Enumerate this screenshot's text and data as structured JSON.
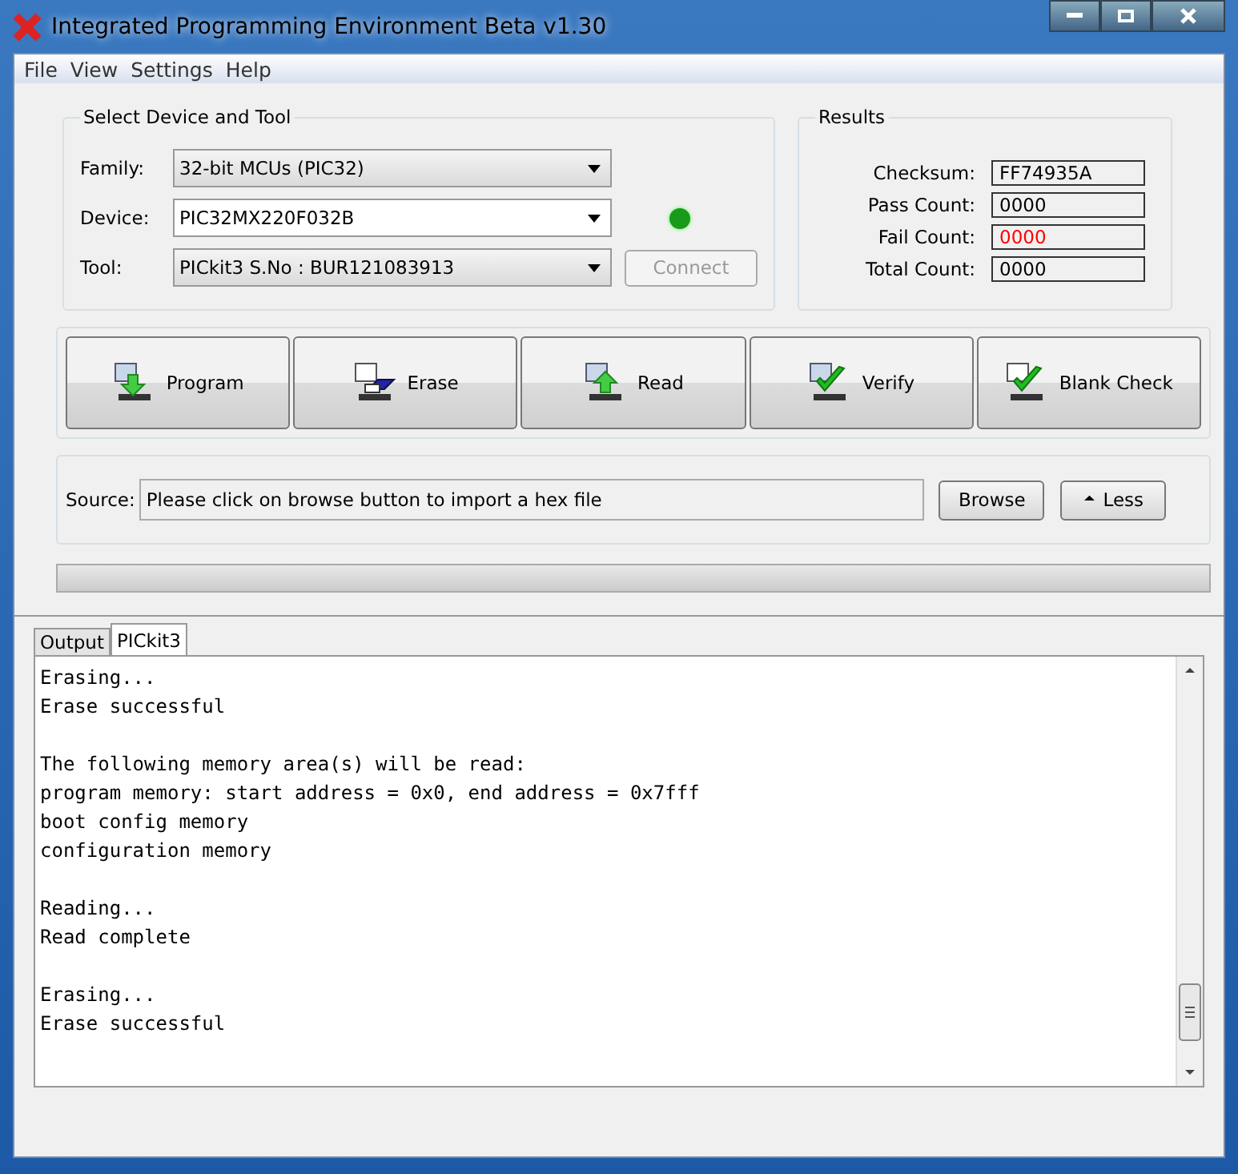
{
  "window": {
    "title": "Integrated Programming Environment Beta v1.30"
  },
  "menu": [
    "File",
    "View",
    "Settings",
    "Help"
  ],
  "device_panel": {
    "title": "Select Device and Tool",
    "fields": [
      {
        "label": "Family:",
        "value": "32-bit MCUs (PIC32)",
        "editable": false
      },
      {
        "label": "Device:",
        "value": "PIC32MX220F032B",
        "editable": true
      },
      {
        "label": "Tool:",
        "value": "PICkit3 S.No : BUR121083913",
        "editable": false
      }
    ],
    "status_led": {
      "on": true
    },
    "connect_button": {
      "label": "Connect",
      "disabled": true
    }
  },
  "results": {
    "title": "Results",
    "rows": [
      {
        "label": "Checksum:",
        "value": "FF74935A",
        "color": "#000000"
      },
      {
        "label": "Pass Count:",
        "value": "0000",
        "color": "#000000"
      },
      {
        "label": "Fail Count:",
        "value": "0000",
        "color": "#ff0000"
      },
      {
        "label": "Total Count:",
        "value": "0000",
        "color": "#000000"
      }
    ]
  },
  "actions": [
    {
      "label": "Program",
      "kind": "program"
    },
    {
      "label": "Erase",
      "kind": "erase"
    },
    {
      "label": "Read",
      "kind": "read"
    },
    {
      "label": "Verify",
      "kind": "verify"
    },
    {
      "label": "Blank Check",
      "kind": "blank"
    }
  ],
  "source": {
    "label": "Source:",
    "placeholder": "Please click on browse button to import a hex file",
    "browse": "Browse",
    "less_icon": "⏶",
    "less": "Less"
  },
  "progress": {
    "level": 0
  },
  "tabs": [
    {
      "label": "Output",
      "selected": false
    },
    {
      "label": "PICkit3",
      "selected": true
    }
  ],
  "log": [
    [
      "Erasing...",
      "Erase successful"
    ],
    [
      "The following memory area(s) will be read:",
      "program memory: start address = 0x0, end address = 0x7fff",
      "boot config memory",
      "configuration memory"
    ],
    [
      "Reading...",
      "Read complete"
    ],
    [
      "Erasing...",
      "Erase successful"
    ]
  ]
}
